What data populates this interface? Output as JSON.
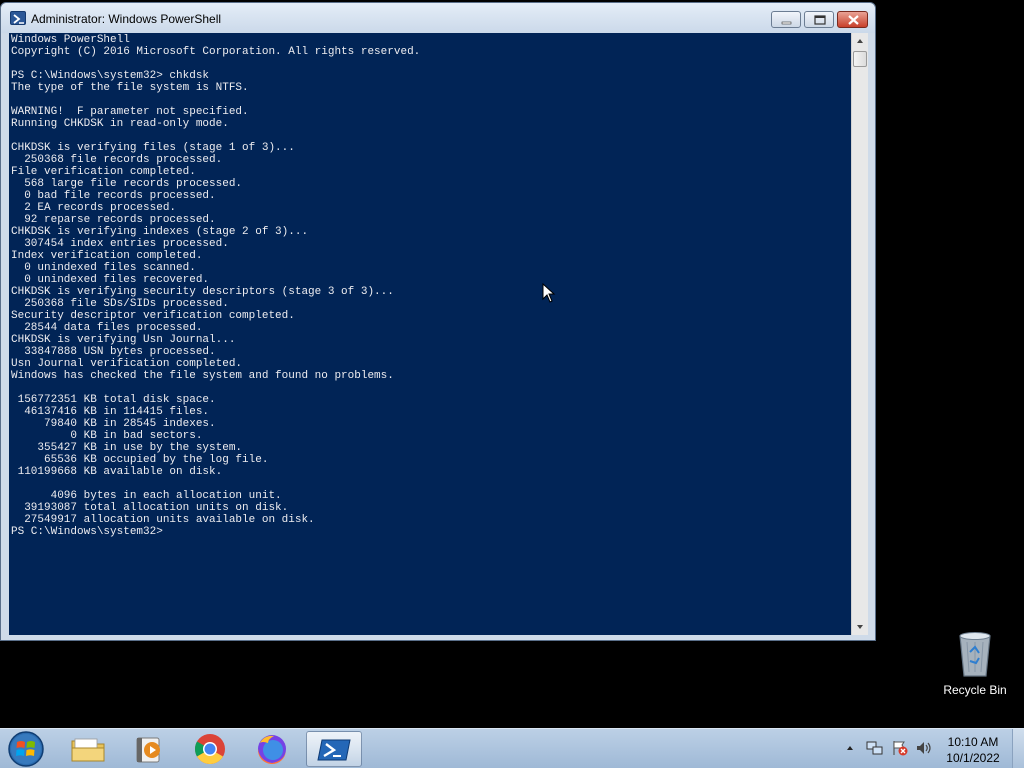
{
  "window": {
    "title": "Administrator: Windows PowerShell",
    "console_text": "Windows PowerShell\nCopyright (C) 2016 Microsoft Corporation. All rights reserved.\n\nPS C:\\Windows\\system32> chkdsk\nThe type of the file system is NTFS.\n\nWARNING!  F parameter not specified.\nRunning CHKDSK in read-only mode.\n\nCHKDSK is verifying files (stage 1 of 3)...\n  250368 file records processed.\nFile verification completed.\n  568 large file records processed.\n  0 bad file records processed.\n  2 EA records processed.\n  92 reparse records processed.\nCHKDSK is verifying indexes (stage 2 of 3)...\n  307454 index entries processed.\nIndex verification completed.\n  0 unindexed files scanned.\n  0 unindexed files recovered.\nCHKDSK is verifying security descriptors (stage 3 of 3)...\n  250368 file SDs/SIDs processed.\nSecurity descriptor verification completed.\n  28544 data files processed.\nCHKDSK is verifying Usn Journal...\n  33847888 USN bytes processed.\nUsn Journal verification completed.\nWindows has checked the file system and found no problems.\n\n 156772351 KB total disk space.\n  46137416 KB in 114415 files.\n     79840 KB in 28545 indexes.\n         0 KB in bad sectors.\n    355427 KB in use by the system.\n     65536 KB occupied by the log file.\n 110199668 KB available on disk.\n\n      4096 bytes in each allocation unit.\n  39193087 total allocation units on disk.\n  27549917 allocation units available on disk.\nPS C:\\Windows\\system32>",
    "console_bg": "#012456",
    "console_fg": "#eeedf0"
  },
  "desktop": {
    "recycle_bin_label": "Recycle Bin"
  },
  "taskbar": {
    "pinned": [
      "windows-explorer-icon",
      "media-player-icon",
      "chrome-icon",
      "firefox-icon",
      "powershell-icon"
    ],
    "active_app": "powershell-icon",
    "tray_icons": [
      "show-hidden-icons-icon",
      "network-icon",
      "action-center-icon",
      "volume-icon"
    ],
    "clock": {
      "time": "10:10 AM",
      "date": "10/1/2022"
    }
  }
}
